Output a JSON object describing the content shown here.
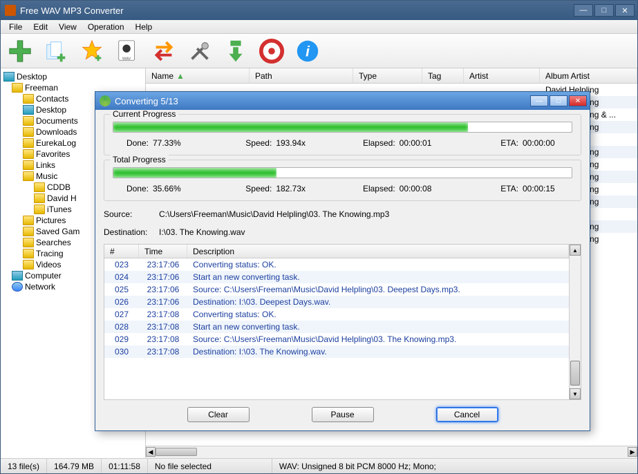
{
  "app": {
    "title": "Free WAV MP3 Converter"
  },
  "menu": {
    "file": "File",
    "edit": "Edit",
    "view": "View",
    "operation": "Operation",
    "help": "Help"
  },
  "listHeaders": {
    "name": "Name",
    "path": "Path",
    "type": "Type",
    "tag": "Tag",
    "artist": "Artist",
    "albumArtist": "Album Artist"
  },
  "artists": [
    "David Helpling",
    "David Helpling",
    "David Helpling & ...",
    "David Helpling",
    "",
    "David Helpling",
    "David Helpling",
    "David Helpling",
    "David Helpling",
    "David Helpling",
    "",
    "David Helpling",
    "David Helpling"
  ],
  "tree": [
    {
      "t": "Desktop",
      "lvl": 0,
      "ico": "monitor"
    },
    {
      "t": "Freeman",
      "lvl": 1,
      "ico": "folder"
    },
    {
      "t": "Contacts",
      "lvl": 2,
      "ico": "folder"
    },
    {
      "t": "Desktop",
      "lvl": 2,
      "ico": "monitor"
    },
    {
      "t": "Documents",
      "lvl": 2,
      "ico": "folder"
    },
    {
      "t": "Downloads",
      "lvl": 2,
      "ico": "folder"
    },
    {
      "t": "EurekaLog",
      "lvl": 2,
      "ico": "folder"
    },
    {
      "t": "Favorites",
      "lvl": 2,
      "ico": "folder"
    },
    {
      "t": "Links",
      "lvl": 2,
      "ico": "folder"
    },
    {
      "t": "Music",
      "lvl": 2,
      "ico": "folder"
    },
    {
      "t": "CDDB",
      "lvl": 3,
      "ico": "folder"
    },
    {
      "t": "David H",
      "lvl": 3,
      "ico": "folder"
    },
    {
      "t": "iTunes",
      "lvl": 3,
      "ico": "folder"
    },
    {
      "t": "Pictures",
      "lvl": 2,
      "ico": "folder"
    },
    {
      "t": "Saved Gam",
      "lvl": 2,
      "ico": "folder"
    },
    {
      "t": "Searches",
      "lvl": 2,
      "ico": "folder"
    },
    {
      "t": "Tracing",
      "lvl": 2,
      "ico": "folder"
    },
    {
      "t": "Videos",
      "lvl": 2,
      "ico": "folder"
    },
    {
      "t": "Computer",
      "lvl": 1,
      "ico": "monitor"
    },
    {
      "t": "Network",
      "lvl": 1,
      "ico": "net"
    }
  ],
  "status": {
    "files": "13 file(s)",
    "size": "164.79 MB",
    "dur": "01:11:58",
    "sel": "No file selected",
    "fmt": "WAV:   Unsigned 8 bit PCM  8000 Hz;  Mono;"
  },
  "dialog": {
    "title": "Converting 5/13",
    "current": {
      "title": "Current Progress",
      "doneLabel": "Done:",
      "done": "77.33%",
      "speedLabel": "Speed:",
      "speed": "193.94x",
      "elapsedLabel": "Elapsed:",
      "elapsed": "00:00:01",
      "etaLabel": "ETA:",
      "eta": "00:00:00",
      "pct": 77.33
    },
    "total": {
      "title": "Total Progress",
      "doneLabel": "Done:",
      "done": "35.66%",
      "speedLabel": "Speed:",
      "speed": "182.73x",
      "elapsedLabel": "Elapsed:",
      "elapsed": "00:00:08",
      "etaLabel": "ETA:",
      "eta": "00:00:15",
      "pct": 35.66
    },
    "sourceLabel": "Source:",
    "source": "C:\\Users\\Freeman\\Music\\David Helpling\\03. The Knowing.mp3",
    "destLabel": "Destination:",
    "dest": "I:\\03. The Knowing.wav",
    "logHeaders": {
      "num": "#",
      "time": "Time",
      "desc": "Description"
    },
    "log": [
      {
        "n": "023",
        "t": "23:17:06",
        "d": "Converting status: OK."
      },
      {
        "n": "024",
        "t": "23:17:06",
        "d": "Start an new converting task."
      },
      {
        "n": "025",
        "t": "23:17:06",
        "d": "Source:  C:\\Users\\Freeman\\Music\\David Helpling\\03. Deepest Days.mp3."
      },
      {
        "n": "026",
        "t": "23:17:06",
        "d": "Destination: I:\\03. Deepest Days.wav."
      },
      {
        "n": "027",
        "t": "23:17:08",
        "d": "Converting status: OK."
      },
      {
        "n": "028",
        "t": "23:17:08",
        "d": "Start an new converting task."
      },
      {
        "n": "029",
        "t": "23:17:08",
        "d": "Source:  C:\\Users\\Freeman\\Music\\David Helpling\\03. The Knowing.mp3."
      },
      {
        "n": "030",
        "t": "23:17:08",
        "d": "Destination: I:\\03. The Knowing.wav."
      }
    ],
    "buttons": {
      "clear": "Clear",
      "pause": "Pause",
      "cancel": "Cancel"
    }
  }
}
